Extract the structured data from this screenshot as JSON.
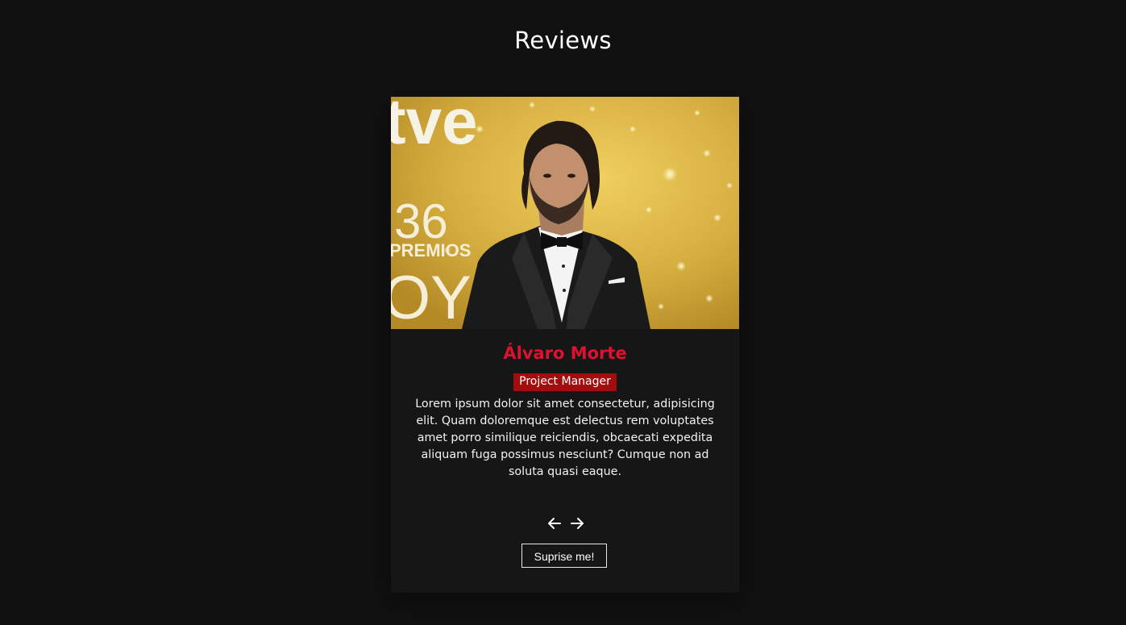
{
  "section": {
    "title": "Reviews"
  },
  "review": {
    "name": "Álvaro Morte",
    "role": "Project Manager",
    "text": "Lorem ipsum dolor sit amet consectetur, adipisicing elit. Quam doloremque est delectus rem voluptates amet porro similique reiciendis, obcaecati expedita aliquam fuga possimus nesciunt? Cumque non ad soluta quasi eaque.",
    "photo_backdrop_text": [
      "tve",
      "36",
      "PREMIOS",
      "OY"
    ]
  },
  "controls": {
    "prev_icon": "arrow-left-icon",
    "next_icon": "arrow-right-icon",
    "surprise_label": "Suprise me!"
  },
  "colors": {
    "background": "#111112",
    "card": "#161617",
    "name_accent": "#e0102e",
    "role_badge": "#a20d0d",
    "photo_backdrop": "#d8b443"
  }
}
